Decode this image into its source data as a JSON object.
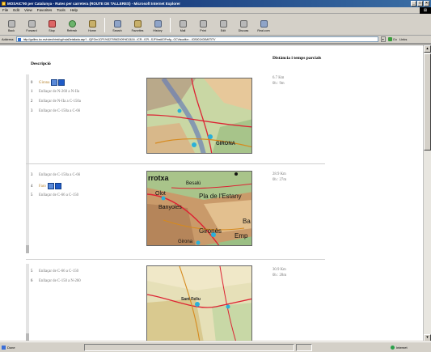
{
  "window": {
    "title": "MOSAIC'90 per Catalunya - Rutes per carretera (ROUTE DE TALLERES) - Microsoft Internet Explorer"
  },
  "menu": [
    "File",
    "Edit",
    "View",
    "Favorites",
    "Tools",
    "Help"
  ],
  "toolbar": {
    "back": "Back",
    "forward": "Forward",
    "stop": "Stop",
    "refresh": "Refresh",
    "home": "Home",
    "search": "Search",
    "favorites": "Favorites",
    "history": "History",
    "mail": "Mail",
    "print": "Print",
    "edit": "Edit",
    "discuss": "Discuss",
    "realjukebox": "Real.com"
  },
  "address": {
    "label": "Address",
    "url": "http://galileu.icc.es/rutes/html/cgi/rutaDetallada.asp?...IQFOrn1CP1%D27096OX09%D2&16...ICR...ICR...SJFVest0OFmfg...OCVisualitz=...ICB001X00M0TITV",
    "go_label": "Go",
    "links_label": "Links"
  },
  "headers": {
    "description": "Descripció",
    "distance": "Distància i temps parcials"
  },
  "sections": [
    {
      "rows": [
        {
          "num": "0",
          "text": "Girona",
          "is_place": true
        },
        {
          "num": "1",
          "text": "Enllaçar de N-260 a N-IIa"
        },
        {
          "num": "2",
          "text": "Enllaçar de N-IIa a C-150a"
        },
        {
          "num": "3",
          "text": "Enllaçar de C-150a a C-66"
        }
      ],
      "distance": "6.7 Km",
      "time": "0h : 9m",
      "map_labels": [
        "GIRONA"
      ]
    },
    {
      "rows": [
        {
          "num": "3",
          "text": "Enllaçar de C-150a a C-66"
        },
        {
          "num": "4",
          "text": "Faro",
          "is_place": true
        },
        {
          "num": "5",
          "text": "Enllaçar de C-66 a C-150"
        }
      ],
      "distance": "28.9 Km",
      "time": "0h : 27m",
      "map_labels": [
        "rrotxa",
        "Besalú",
        "Olot",
        "Pla de l'Estany",
        "Banyoles",
        "Gironès",
        "Girona",
        "Emp",
        "Ba"
      ]
    },
    {
      "rows": [
        {
          "num": "5",
          "text": "Enllaçar de C-66 a C-150"
        },
        {
          "num": "6",
          "text": "Enllaçar de C-150 a N-260"
        }
      ],
      "distance": "30.9 Km",
      "time": "0h : 28m",
      "map_labels": [
        "Sant Feliu"
      ]
    }
  ],
  "status": {
    "done": "Done",
    "zone": "Internet"
  },
  "colors": {
    "titlebar": "#0a246a",
    "place": "#b5822c",
    "link_icon": "#1f5bc7"
  }
}
